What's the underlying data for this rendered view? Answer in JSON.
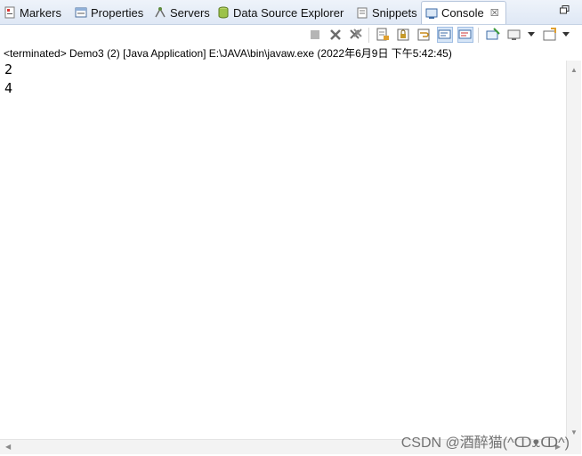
{
  "tabs": [
    {
      "label": "Markers",
      "icon": "markers-icon"
    },
    {
      "label": "Properties",
      "icon": "properties-icon"
    },
    {
      "label": "Servers",
      "icon": "servers-icon"
    },
    {
      "label": "Data Source Explorer",
      "icon": "data-source-icon"
    },
    {
      "label": "Snippets",
      "icon": "snippets-icon"
    },
    {
      "label": "Console",
      "icon": "console-icon",
      "active": true,
      "close": "☒"
    }
  ],
  "toolbar": {
    "icons": [
      "terminate-icon",
      "remove-launch-icon",
      "remove-all-terminated-icon",
      "clear-console-icon",
      "scroll-lock-icon",
      "word-wrap-icon",
      "show-console-on-stdout-icon",
      "show-console-on-stderr-icon",
      "pin-console-icon",
      "display-selected-console-icon",
      "open-console-icon"
    ]
  },
  "status": "<terminated> Demo3 (2) [Java Application] E:\\JAVA\\bin\\javaw.exe (2022年6月9日 下午5:42:45)",
  "output": [
    "2",
    "4"
  ],
  "watermark": "CSDN @酒醉猫(^ↀᴥↀ^)"
}
